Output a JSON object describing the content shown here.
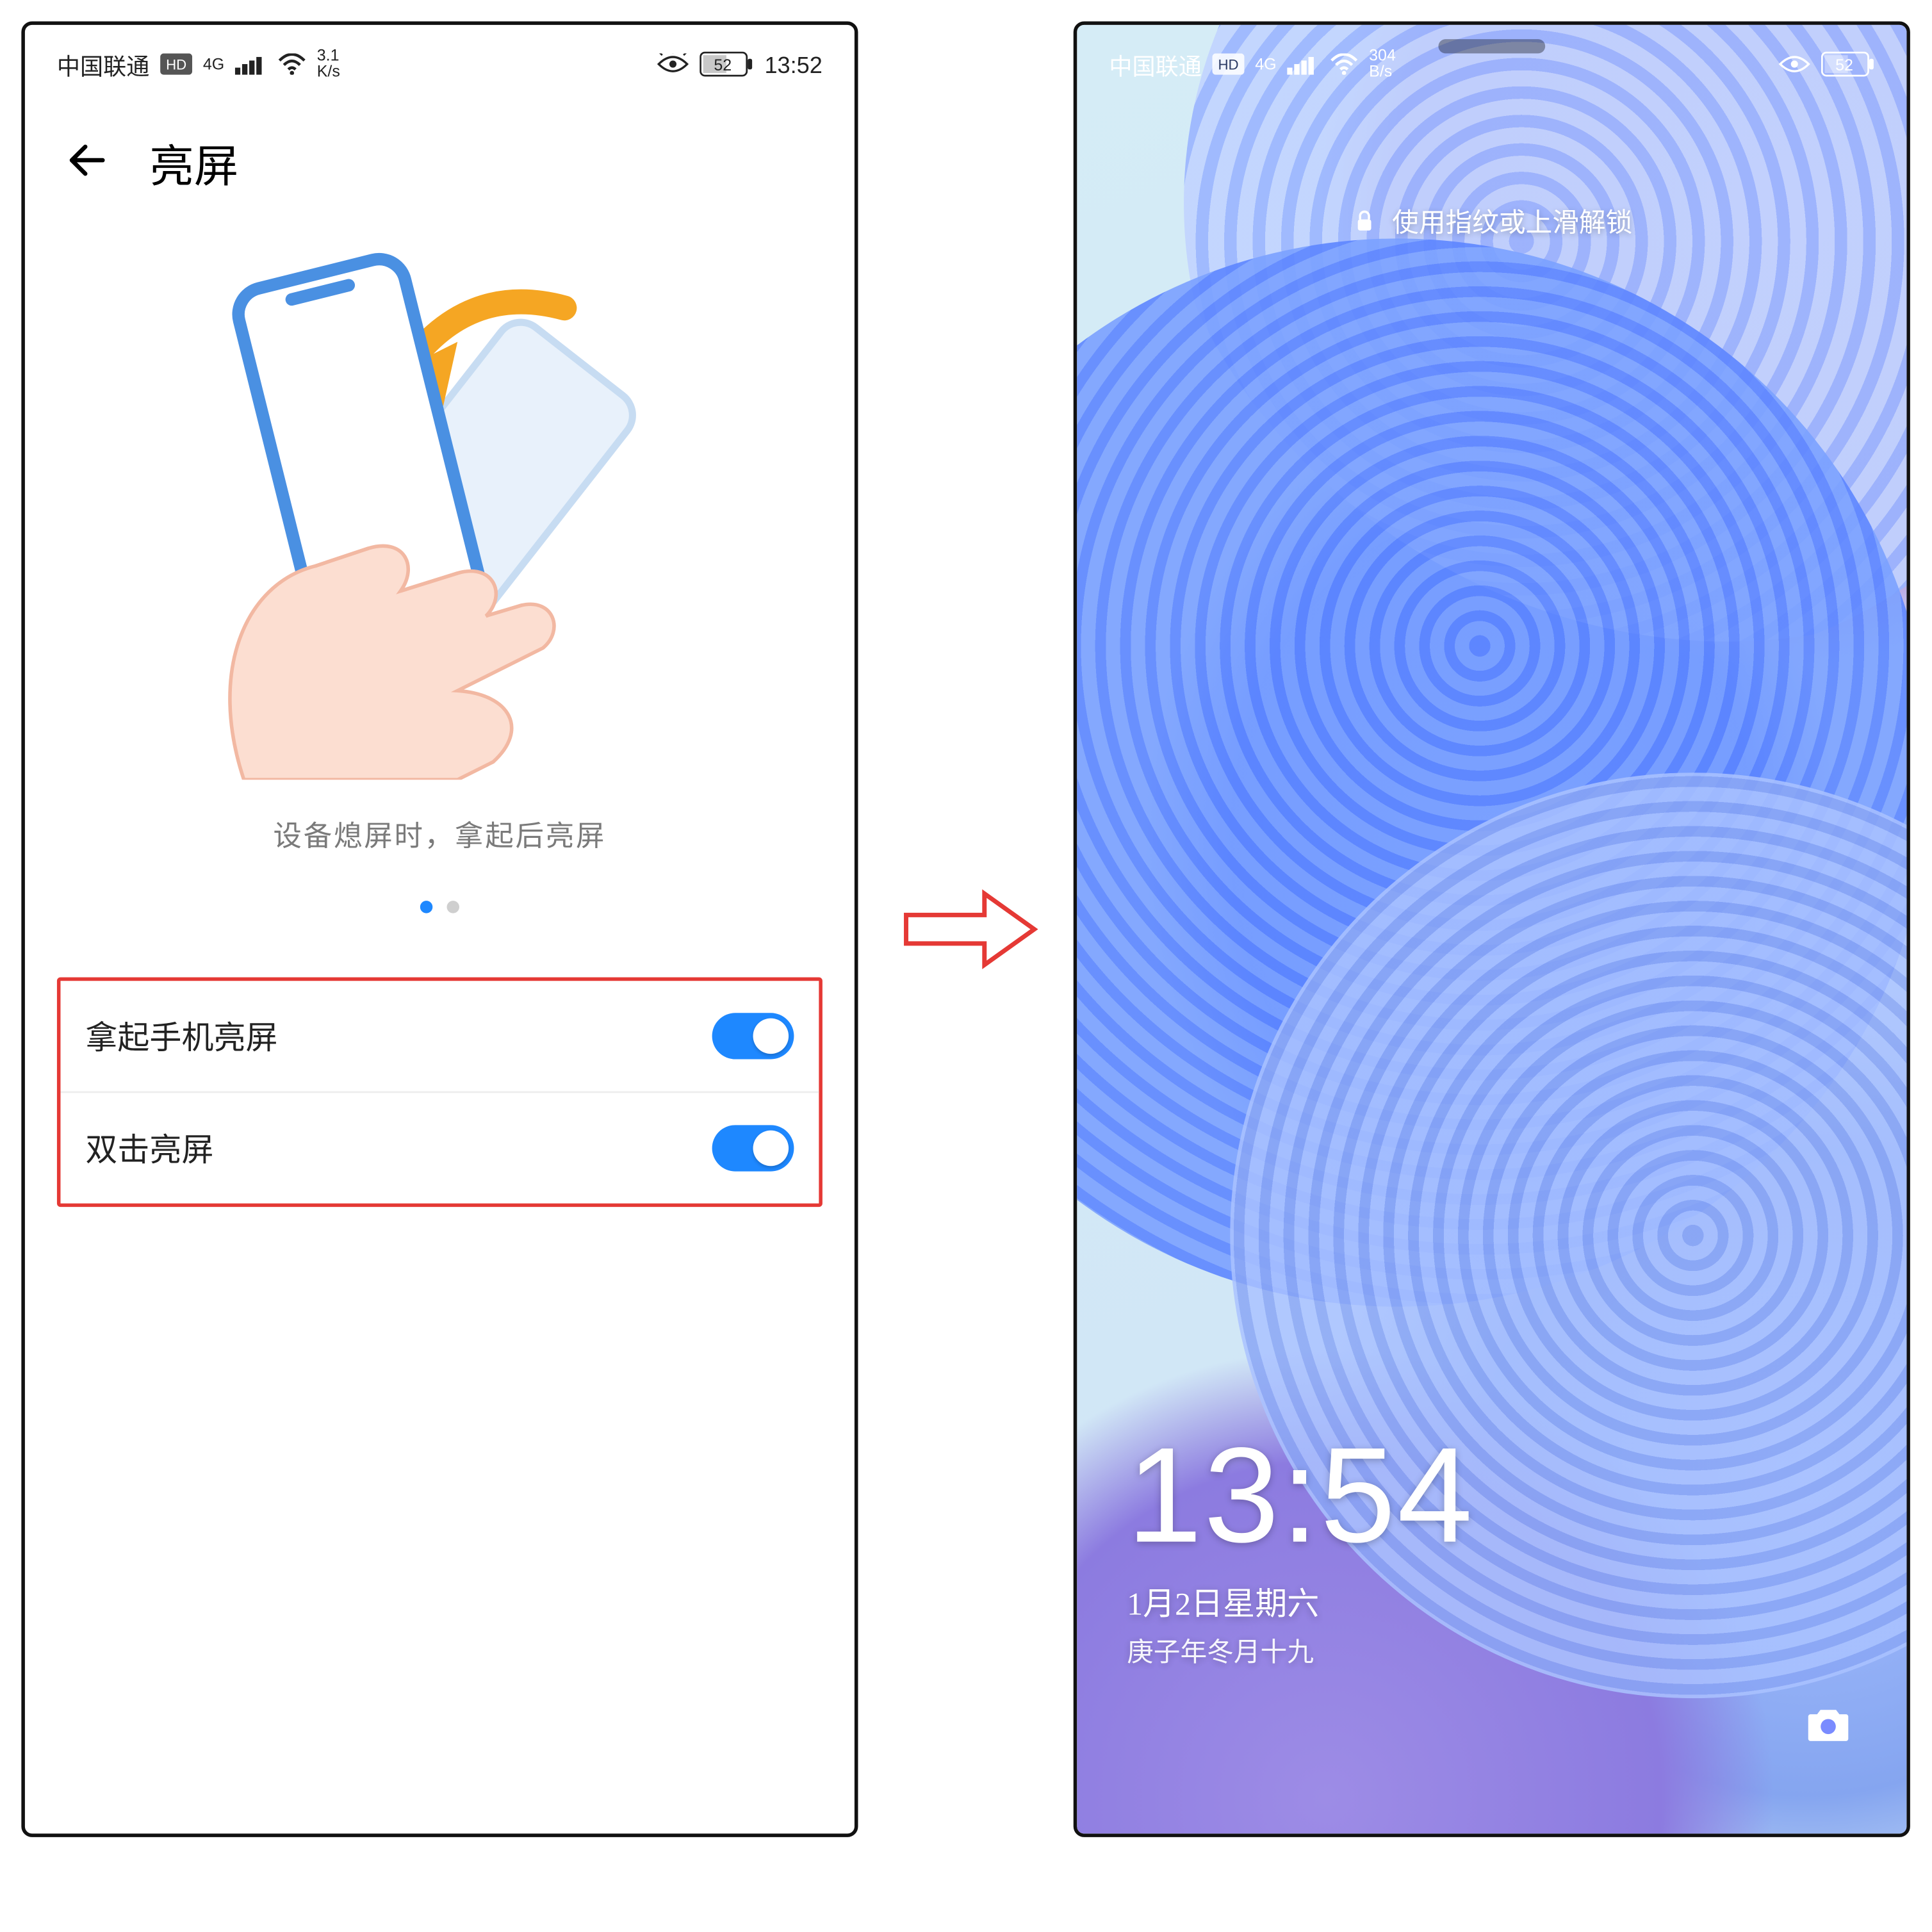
{
  "left": {
    "status": {
      "carrier": "中国联通",
      "hd": "HD",
      "net": "4G",
      "speed_top": "3.1",
      "speed_bot": "K/s",
      "battery": "52",
      "time": "13:52"
    },
    "title": "亮屏",
    "illustration_caption": "设备熄屏时，拿起后亮屏",
    "settings": [
      {
        "label": "拿起手机亮屏",
        "on": true
      },
      {
        "label": "双击亮屏",
        "on": true
      }
    ]
  },
  "right": {
    "status": {
      "carrier": "中国联通",
      "hd": "HD",
      "net": "4G",
      "speed_top": "304",
      "speed_bot": "B/s",
      "battery": "52"
    },
    "lock_hint": "使用指纹或上滑解锁",
    "clock": {
      "time": "13:54",
      "date": "1月2日星期六",
      "lunar": "庚子年冬月十九"
    }
  }
}
